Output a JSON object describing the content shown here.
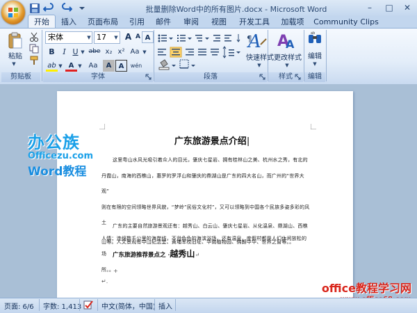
{
  "window": {
    "title": "批量删除Word中的所有图片.docx - Microsoft Word",
    "minimize": "–",
    "maximize": "□",
    "close": "✕"
  },
  "tabs": [
    "开始",
    "插入",
    "页面布局",
    "引用",
    "邮件",
    "审阅",
    "视图",
    "开发工具",
    "加载项",
    "Community Clips"
  ],
  "ribbon": {
    "clipboard": {
      "label": "剪贴板",
      "paste": "粘贴"
    },
    "font": {
      "label": "字体",
      "font_name": "宋体",
      "font_size": "17",
      "grow": "A",
      "shrink": "A",
      "clear": "A",
      "bold": "B",
      "italic": "I",
      "underline": "U",
      "strike": "abe",
      "subscript": "x₂",
      "superscript": "x²",
      "change_case": "Aa",
      "highlight": "ab",
      "font_color": "A",
      "char_shading": "A",
      "char_border": "A",
      "phonetic": "wén"
    },
    "paragraph": {
      "label": "段落"
    },
    "styles": {
      "label": "样式",
      "quick_styles": "快速样式",
      "change_styles": "更改样式"
    },
    "editing": {
      "label": "编辑",
      "edit": "编辑"
    }
  },
  "document": {
    "title": "广东旅游景点介绍",
    "para1": [
      "这里粤山水风光吸引着众人的目光，肇庆七星岩、拥有桂林山之美、杭州水之秀，有北的",
      "丹霞山，南海的西樵山，惠罗的罗浮山和肇庆的鼎湖山是广东的四大名山，而广州的“世界大观”",
      "则在有限的空间领略世界风貌，“梦岭”民俗文化村”，又可以领略到中国各个民族多姿多彩的风土",
      "人情；连绵数千公里的海岸线，不逊色色的海滨浴场，还有温泉，度假村都是人们休闲放松的场",
      "所。。"
    ],
    "para2": [
      "广东的主要自然旅游景观还有：越秀山、白云山、肇庆七星岩、从化温泉、鼎湖山、西樵",
      "山等。人文景观有中山纪念堂、黄埔军校旧址、华南植物园、佛朗中华、世界之窗等。。"
    ],
    "recommend_label": "广东旅游推荐景点之 ·",
    "recommend_value": "越秀山",
    "cursor_mark": "+",
    "end_mark": "↵."
  },
  "watermark": {
    "brand": "办公族",
    "url": "Officezu.com",
    "word": "Word教程",
    "site": "office教程学习网",
    "site_url": "www.office68.com"
  },
  "status": {
    "page": "页面: 6/6",
    "words": "字数: 1,413",
    "language": "中文(简体，中国)",
    "mode": "插入"
  },
  "colors": {
    "accent": "#c2d6ee",
    "brand_blue": "#1aa0e8",
    "watermark_red": "#d9261c"
  }
}
